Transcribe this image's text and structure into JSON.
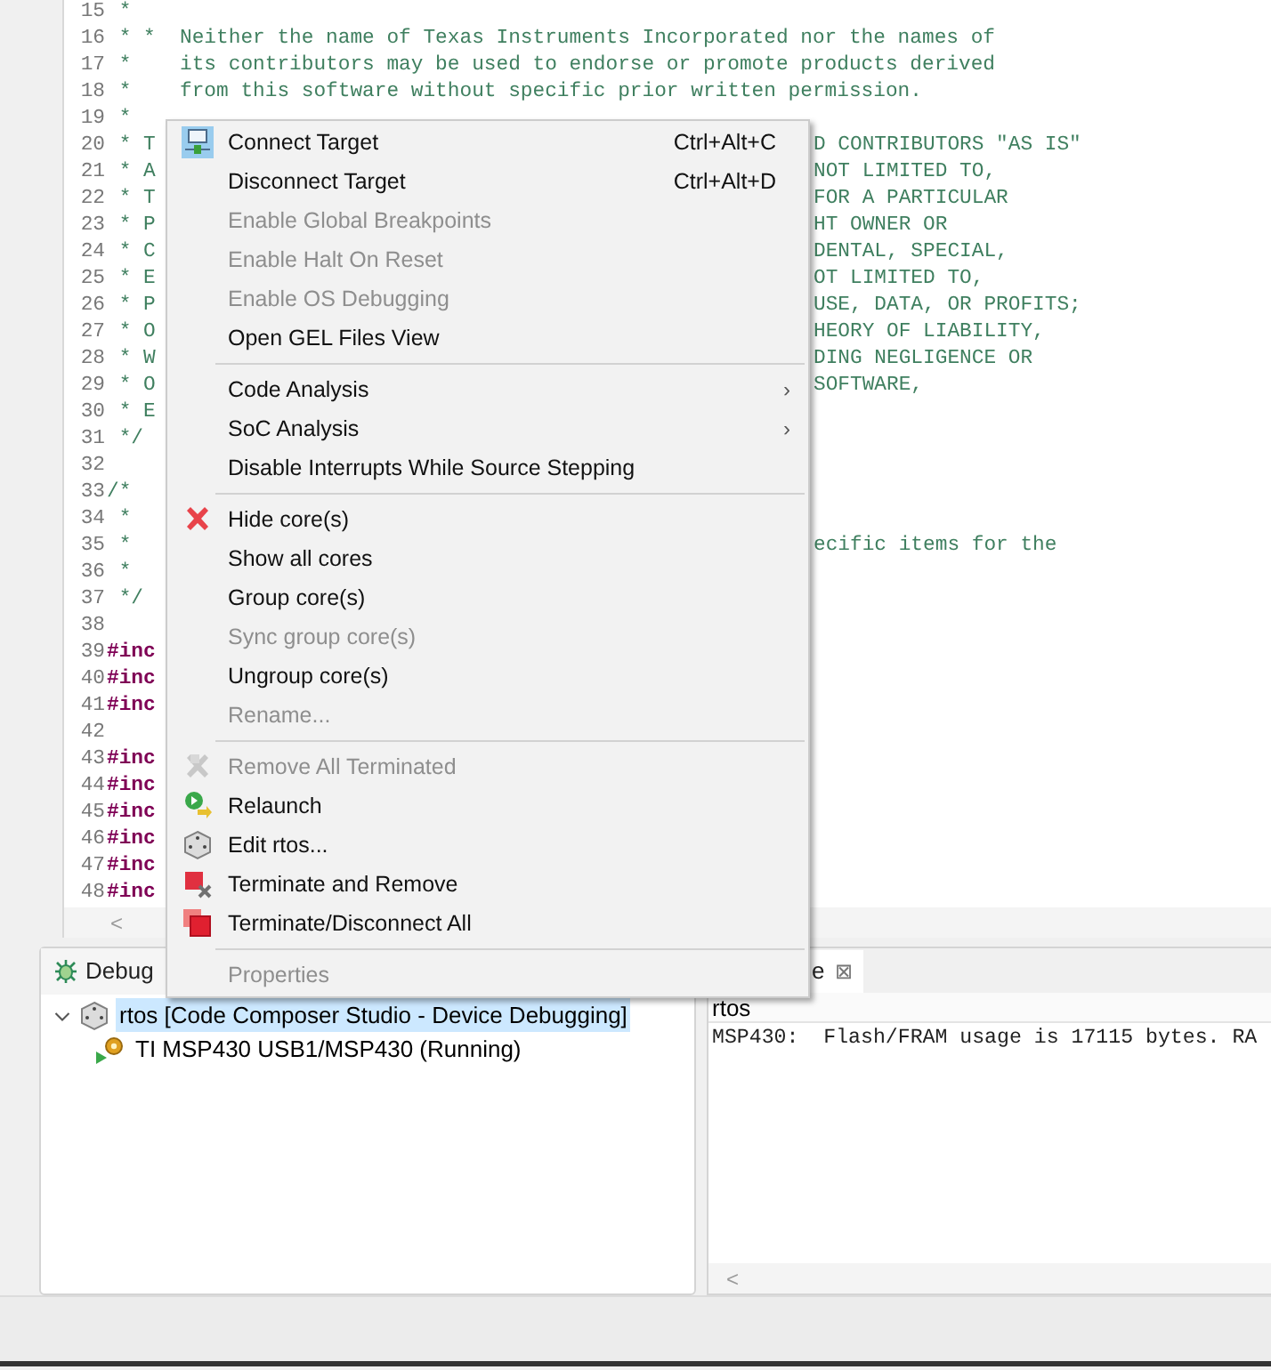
{
  "editor": {
    "lines": [
      {
        "number": "15",
        "text": " *",
        "kind": "comment"
      },
      {
        "number": "16",
        "text": " * *  Neither the name of Texas Instruments Incorporated nor the names of",
        "kind": "comment"
      },
      {
        "number": "17",
        "text": " *    its contributors may be used to endorse or promote products derived",
        "kind": "comment"
      },
      {
        "number": "18",
        "text": " *    from this software without specific prior written permission.",
        "kind": "comment"
      },
      {
        "number": "19",
        "text": " *",
        "kind": "comment"
      },
      {
        "number": "20",
        "text": " * T",
        "right": "D CONTRIBUTORS \"AS IS\"",
        "kind": "comment"
      },
      {
        "number": "21",
        "text": " * A",
        "right": "NOT LIMITED TO,",
        "kind": "comment"
      },
      {
        "number": "22",
        "text": " * T",
        "right": "FOR A PARTICULAR",
        "kind": "comment"
      },
      {
        "number": "23",
        "text": " * P",
        "right": "HT OWNER OR",
        "kind": "comment"
      },
      {
        "number": "24",
        "text": " * C",
        "right": "DENTAL, SPECIAL,",
        "kind": "comment"
      },
      {
        "number": "25",
        "text": " * E",
        "right": "OT LIMITED TO,",
        "kind": "comment"
      },
      {
        "number": "26",
        "text": " * P",
        "right": "USE, DATA, OR PROFITS;",
        "kind": "comment"
      },
      {
        "number": "27",
        "text": " * O",
        "right": "HEORY OF LIABILITY,",
        "kind": "comment"
      },
      {
        "number": "28",
        "text": " * W",
        "right": "DING NEGLIGENCE OR",
        "kind": "comment"
      },
      {
        "number": "29",
        "text": " * O",
        "right": "SOFTWARE,",
        "kind": "comment"
      },
      {
        "number": "30",
        "text": " * E",
        "kind": "comment"
      },
      {
        "number": "31",
        "text": " */",
        "kind": "comment"
      },
      {
        "number": "32"
      },
      {
        "number": "33",
        "text": "/*",
        "kind": "comment"
      },
      {
        "number": "34",
        "text": " *",
        "kind": "comment"
      },
      {
        "number": "35",
        "text": " *",
        "right": "ecific items for the",
        "kind": "comment"
      },
      {
        "number": "36",
        "text": " *",
        "kind": "comment"
      },
      {
        "number": "37",
        "text": " */",
        "kind": "comment"
      },
      {
        "number": "38"
      },
      {
        "number": "39",
        "text": "#inc",
        "kind": "directive"
      },
      {
        "number": "40",
        "text": "#inc",
        "kind": "directive"
      },
      {
        "number": "41",
        "text": "#inc",
        "kind": "directive"
      },
      {
        "number": "42"
      },
      {
        "number": "43",
        "text": "#inc",
        "kind": "directive"
      },
      {
        "number": "44",
        "text": "#inc",
        "kind": "directive"
      },
      {
        "number": "45",
        "text": "#inc",
        "kind": "directive"
      },
      {
        "number": "46",
        "text": "#inc",
        "kind": "directive"
      },
      {
        "number": "47",
        "text": "#inc",
        "kind": "directive"
      },
      {
        "number": "48",
        "text": "#inc",
        "kind": "directive"
      }
    ],
    "scroll_left": "<"
  },
  "context_menu": {
    "groups": [
      [
        {
          "label": "Connect Target",
          "shortcut": "Ctrl+Alt+C",
          "disabled": false
        },
        {
          "label": "Disconnect Target",
          "shortcut": "Ctrl+Alt+D",
          "disabled": false
        },
        {
          "label": "Enable Global Breakpoints",
          "disabled": true
        },
        {
          "label": "Enable Halt On Reset",
          "disabled": true
        },
        {
          "label": "Enable OS Debugging",
          "disabled": true
        },
        {
          "label": "Open GEL Files View",
          "disabled": false
        }
      ],
      [
        {
          "label": "Code Analysis",
          "disabled": false,
          "arrow": "›"
        },
        {
          "label": "SoC Analysis",
          "disabled": false,
          "arrow": "›"
        },
        {
          "label": "Disable Interrupts While Source Stepping",
          "disabled": false
        }
      ],
      [
        {
          "label": "Hide core(s)",
          "disabled": false
        },
        {
          "label": "Show all cores",
          "disabled": false
        },
        {
          "label": "Group core(s)",
          "disabled": false
        },
        {
          "label": "Sync group core(s)",
          "disabled": true
        },
        {
          "label": "Ungroup core(s)",
          "disabled": false
        },
        {
          "label": "Rename...",
          "disabled": true
        }
      ],
      [
        {
          "label": "Remove All Terminated",
          "disabled": true
        },
        {
          "label": "Relaunch",
          "disabled": false
        },
        {
          "label": "Edit rtos...",
          "disabled": false
        },
        {
          "label": "Terminate and Remove",
          "disabled": false
        },
        {
          "label": "Terminate/Disconnect All",
          "disabled": false
        }
      ],
      [
        {
          "label": "Properties",
          "disabled": true
        }
      ]
    ]
  },
  "debug_view": {
    "tab": "Debug",
    "tree": [
      {
        "label": "rtos [Code Composer Studio - Device Debugging]",
        "selected": true,
        "expanded": true,
        "children": [
          {
            "label": "TI MSP430 USB1/MSP430 (Running)",
            "selected": false
          }
        ]
      }
    ]
  },
  "console_view": {
    "tab": "e",
    "close": "⊠",
    "title": "rtos",
    "lines": [
      "MSP430:  Flash/FRAM usage is 17115 bytes. RA"
    ],
    "scroll_left": "<"
  }
}
